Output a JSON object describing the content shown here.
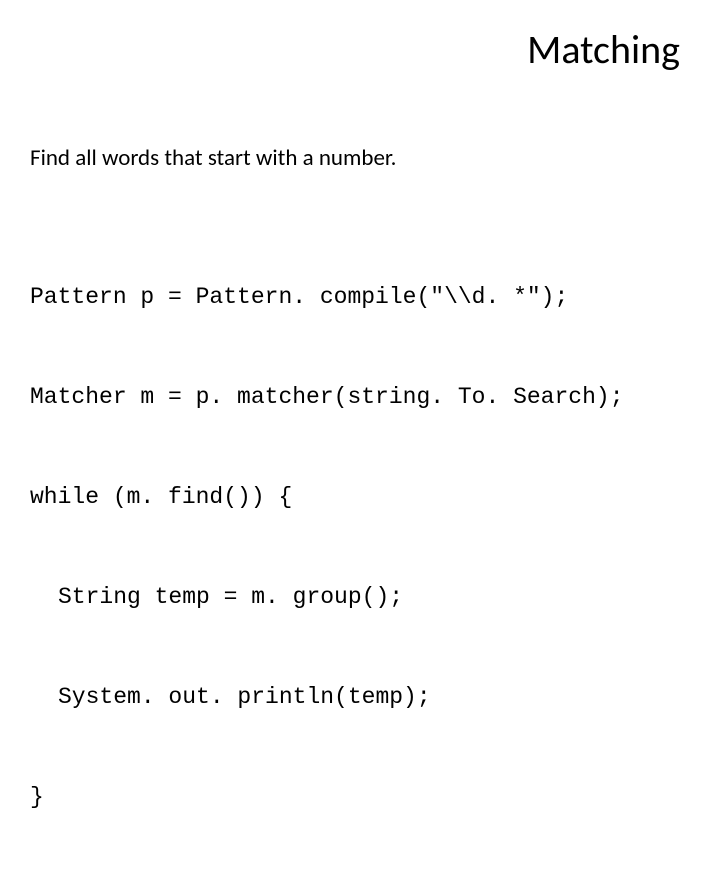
{
  "slide": {
    "title": "Matching",
    "description": "Find all words that start with a number.",
    "code": {
      "line1": "Pattern p = Pattern. compile(\"\\\\d. *\");",
      "line2": "Matcher m = p. matcher(string. To. Search);",
      "line3": "while (m. find()) {",
      "line4": "String temp = m. group();",
      "line5": "System. out. println(temp);",
      "line6": "}"
    }
  }
}
